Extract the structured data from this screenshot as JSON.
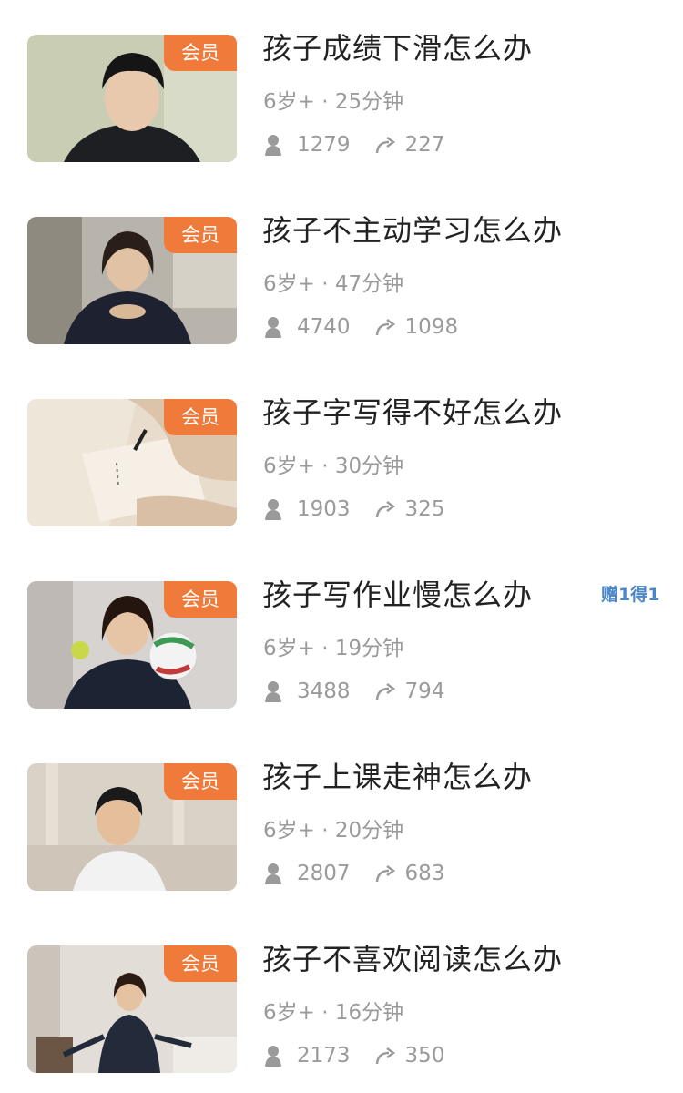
{
  "badge_label": "会员",
  "promo_label": "赠1得1",
  "colors": {
    "badge_bg": "#ef7a3a",
    "promo_text": "#4a86c8",
    "title_text": "#222222",
    "meta_text": "#9a9a9a"
  },
  "courses": [
    {
      "title": "孩子成绩下滑怎么办",
      "meta": "6岁+ · 25分钟",
      "learners": "1279",
      "shares": "227",
      "thumb": "teen-boy-portrait"
    },
    {
      "title": "孩子不主动学习怎么办",
      "meta": "6岁+ · 47分钟",
      "learners": "4740",
      "shares": "1098",
      "thumb": "woman-speaking"
    },
    {
      "title": "孩子字写得不好怎么办",
      "meta": "6岁+ · 30分钟",
      "learners": "1903",
      "shares": "325",
      "thumb": "hand-writing"
    },
    {
      "title": "孩子写作业慢怎么办",
      "meta": "6岁+ · 19分钟",
      "learners": "3488",
      "shares": "794",
      "thumb": "woman-with-balls"
    },
    {
      "title": "孩子上课走神怎么办",
      "meta": "6岁+ · 20分钟",
      "learners": "2807",
      "shares": "683",
      "thumb": "smiling-boy"
    },
    {
      "title": "孩子不喜欢阅读怎么办",
      "meta": "6岁+ · 16分钟",
      "learners": "2173",
      "shares": "350",
      "thumb": "woman-standing"
    }
  ],
  "icons": {
    "learners": "person-icon",
    "shares": "share-arrow-icon"
  }
}
